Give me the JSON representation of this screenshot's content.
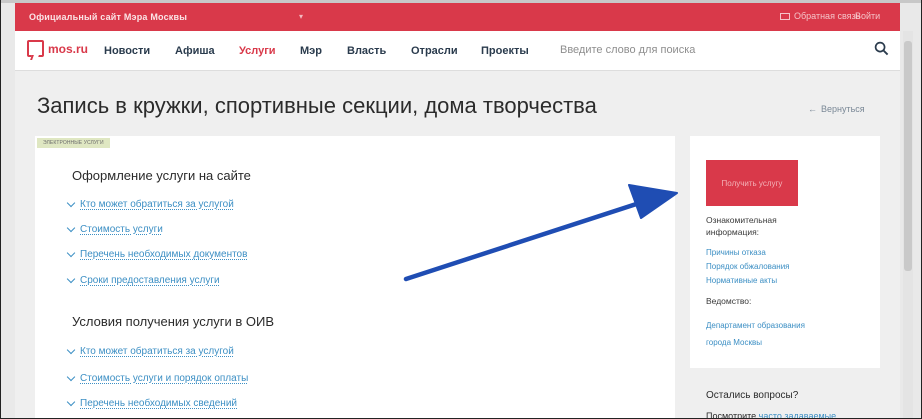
{
  "topbar": {
    "site_name": "Официальный сайт Мэра Москвы",
    "feedback": "Обратная связь",
    "login": "Войти"
  },
  "nav": {
    "logo": "mos.ru",
    "items": [
      {
        "label": "Новости",
        "active": false
      },
      {
        "label": "Афиша",
        "active": false
      },
      {
        "label": "Услуги",
        "active": true
      },
      {
        "label": "Мэр",
        "active": false
      },
      {
        "label": "Власть",
        "active": false
      },
      {
        "label": "Отрасли",
        "active": false
      },
      {
        "label": "Проекты",
        "active": false
      }
    ],
    "search_placeholder": "Введите слово для поиска"
  },
  "page": {
    "title": "Запись в кружки, спортивные секции, дома творчества",
    "back": "Вернуться"
  },
  "main": {
    "tag": "ЭЛЕКТРОННЫЕ УСЛУГИ",
    "section1": {
      "title": "Оформление услуги на сайте",
      "items": [
        "Кто может обратиться за услугой",
        "Стоимость услуги",
        "Перечень необходимых документов",
        "Сроки предоставления услуги"
      ]
    },
    "section2": {
      "title": "Условия получения услуги в ОИВ",
      "items": [
        "Кто может обратиться за услугой",
        "Стоимость услуги и порядок оплаты",
        "Перечень необходимых сведений"
      ]
    }
  },
  "side": {
    "cta": "Получить услугу",
    "info_label_1": "Ознакомительная",
    "info_label_2": "информация:",
    "links": [
      "Причины отказа",
      "Порядок обжалования",
      "Нормативные акты"
    ],
    "dept_label": "Ведомство:",
    "dept_1": "Департамент образования",
    "dept_2": "города Москвы",
    "questions": "Остались вопросы?",
    "faq_prefix": "Посмотрите",
    "faq_link": "часто задаваемые"
  },
  "colors": {
    "brand_red": "#d9394a",
    "link_blue": "#3c8fc4",
    "arrow_blue": "#1f4db3"
  },
  "icons": [
    "search-icon",
    "chevron-down-icon",
    "arrow-left-icon",
    "envelope-icon",
    "logo-icon"
  ]
}
